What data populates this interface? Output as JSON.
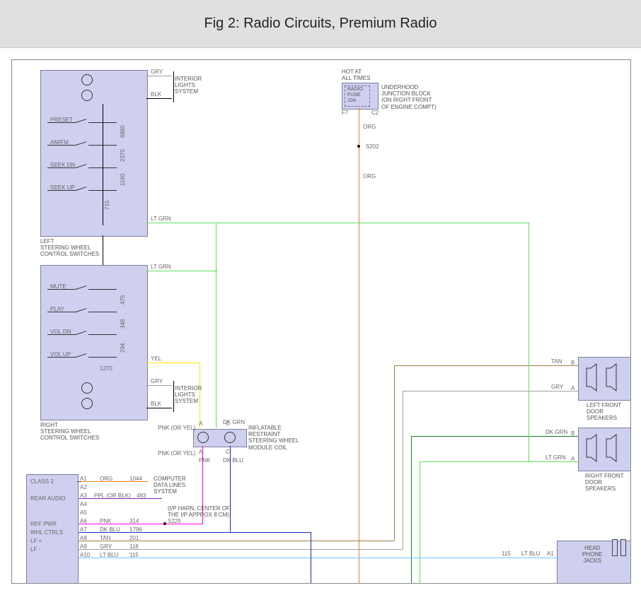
{
  "title": "Fig 2: Radio Circuits, Premium Radio",
  "blocks": {
    "left_sw_top": "LEFT\nSTEERING WHEEL\nCONTROL SWITCHES",
    "left_sw_bot": "RIGHT\nSTEERING WHEEL\nCONTROL SWITCHES",
    "interior_lights": "INTERIOR\nLIGHTS\nSYSTEM",
    "interior_lights2": "INTERIOR\nLIGHTS\nSYSTEM",
    "coil": "INFLATABLE\nRESTRAINT\nSTEERING WHEEL\nMODULE COIL",
    "underhood": "UNDERHOOD\nJUNCTION BLOCK\n(ON RIGHT FRONT\nOF ENGINE COMPT)",
    "hotat": "HOT AT\nALL TIMES",
    "radio_fuse": "RADIO\nFUSE\n10A",
    "lf_spk": "LEFT FRONT\nDOOR SPEAKERS",
    "rf_spk": "RIGHT FRONT\nDOOR SPEAKERS",
    "hp": "HEAD\nPHONE\nJACKS",
    "compdata": "COMPUTER\nDATA LINES\nSYSTEM",
    "iph": "(I/P HARN, CENTER OF\nTHE I/P APPROX 8 CM)"
  },
  "switches_top": [
    "PRESET",
    "AM/FM",
    "SEEK DN",
    "SEEK UP"
  ],
  "switches_bot": [
    "MUTE",
    "PLAY",
    "VOL DN",
    "VOL UP"
  ],
  "res_top": [
    "6880",
    "2370",
    "1160",
    "715"
  ],
  "res_bot": [
    "475",
    "348",
    "294",
    "1270"
  ],
  "wires": {
    "gry": "GRY",
    "blk": "BLK",
    "ltgrn": "LT GRN",
    "yel": "YEL",
    "org": "ORG",
    "dkblu": "DK BLU",
    "pnk": "PNK",
    "pnk_yel": "PNK (OR YEL)",
    "dkgrn": "DK GRN",
    "tan": "TAN",
    "ppl": "PPL (OR BLK)",
    "ltblu": "LT BLU"
  },
  "conn_pins": [
    "A",
    "B",
    "C",
    "F7",
    "C2",
    "S202",
    "S225"
  ],
  "connector": {
    "labels": [
      "CLASS 2",
      "REAR AUDIO",
      "REF PWR",
      "WHL CTRLS",
      "LF +",
      "LF -"
    ],
    "rows": [
      {
        "p": "A1",
        "c": "ORG",
        "n": "1044"
      },
      {
        "p": "A2",
        "c": "",
        "n": ""
      },
      {
        "p": "A3",
        "c": "PPL (OR BLK)",
        "n": "493"
      },
      {
        "p": "A4",
        "c": "",
        "n": ""
      },
      {
        "p": "A5",
        "c": "",
        "n": ""
      },
      {
        "p": "A6",
        "c": "PNK",
        "n": "314"
      },
      {
        "p": "A7",
        "c": "DK BLU",
        "n": "1796"
      },
      {
        "p": "A8",
        "c": "TAN",
        "n": "201"
      },
      {
        "p": "A9",
        "c": "GRY",
        "n": "118"
      },
      {
        "p": "A10",
        "c": "LT BLU",
        "n": "115"
      }
    ]
  },
  "hp_pin": {
    "n": "115",
    "c": "LT BLU",
    "p": "A1"
  },
  "spk_pins": {
    "A": "A",
    "B": "B"
  }
}
